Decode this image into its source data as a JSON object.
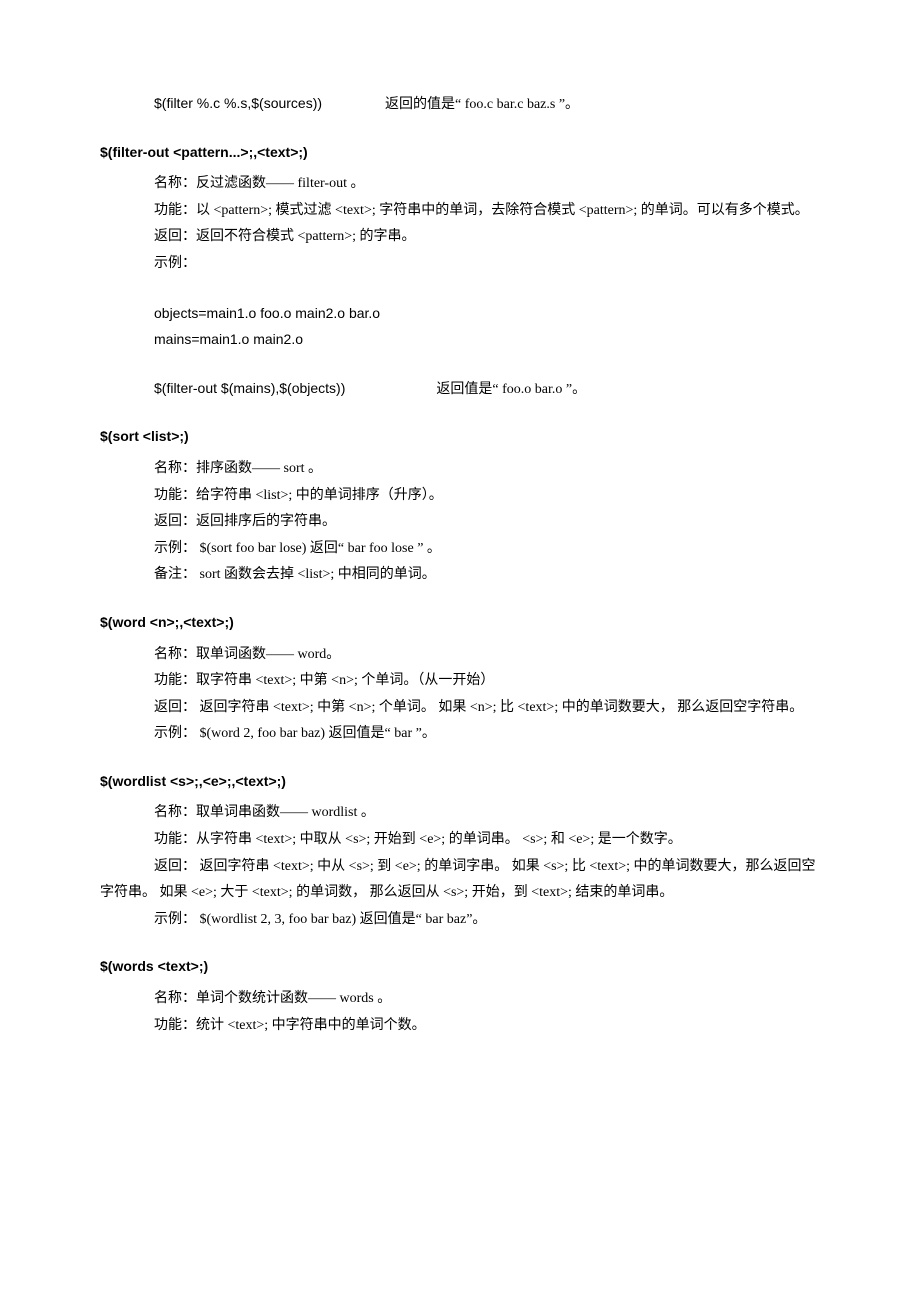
{
  "line1": "$(filter %.c %.s,$(sources))",
  "line1b": "返回的值是“ foo.c    bar.c    baz.s ”。",
  "h1": "$(filter-out <pattern...>;,<text>;)",
  "s1_name": "名称：反过滤函数——    filter-out    。",
  "s1_func": "功能：以 <pattern>;   模式过滤  <text>;  字符串中的单词，去除符合模式    <pattern>;   的单词。可以有多个模式。",
  "s1_ret": "返回：返回不符合模式    <pattern>;    的字串。",
  "s1_ex": "示例：",
  "s1_c1": "objects=main1.o foo.o main2.o bar.o",
  "s1_c2": "mains=main1.o main2.o",
  "s1_c3a": "$(filter-out $(mains),$(objects))",
  "s1_c3b": "返回值是“ foo.o    bar.o ”。",
  "h2": "$(sort <list>;)",
  "s2_name": "名称：排序函数——    sort 。",
  "s2_func": "功能：给字符串   <list>;    中的单词排序（升序）。",
  "s2_ret": "返回：返回排序后的字符串。",
  "s2_ex": "示例：  $(sort foo bar lose)          返回“ bar  foo   lose ”  。",
  "s2_note": "备注：  sort  函数会去掉  <list>;    中相同的单词。",
  "h3": "$(word <n>;,<text>;)",
  "s3_name": "名称：取单词函数——    word。",
  "s3_func": "功能：取字符串   <text>;  中第 <n>; 个单词。（从一开始）",
  "s3_ret": "返回： 返回字符串  <text>;  中第 <n>; 个单词。 如果 <n>; 比 <text>;  中的单词数要大，   那么返回空字符串。",
  "s3_ex": "示例：  $(word 2, foo bar baz)        返回值是“ bar ”。",
  "h4": "$(wordlist <s>;,<e>;,<text>;)",
  "s4_name": "名称：取单词串函数——    wordlist   。",
  "s4_func": "功能：从字符串   <text>;  中取从 <s>; 开始到 <e>; 的单词串。  <s>; 和 <e>; 是一个数字。",
  "s4_ret": "返回： 返回字符串  <text>;  中从 <s>; 到 <e>; 的单词字串。 如果 <s>; 比 <text>;   中的单词数要大，那么返回空字符串。  如果 <e>; 大于 <text>;   的单词数，  那么返回从  <s>; 开始，到 <text>; 结束的单词串。",
  "s4_ex": "示例：   $(wordlist 2, 3, foo bar baz)             返回值是“ bar   baz”。",
  "h5": "$(words <text>;)",
  "s5_name": "名称：单词个数统计函数——    words 。",
  "s5_func": "功能：统计  <text>;   中字符串中的单词个数。"
}
